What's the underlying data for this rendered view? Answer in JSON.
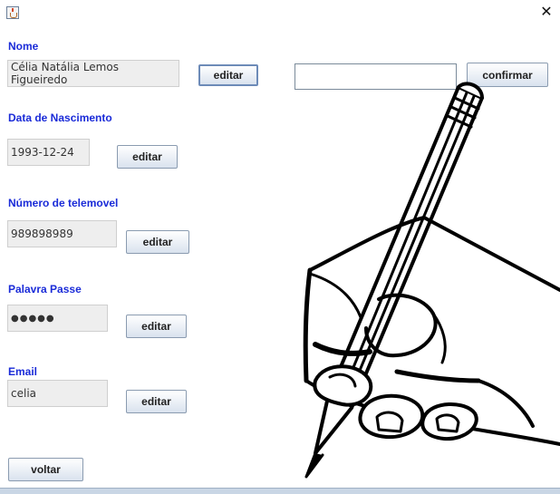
{
  "window": {
    "close_glyph": "✕",
    "icon": "java-cup-icon"
  },
  "fields": {
    "nome": {
      "label": "Nome",
      "value": "Célia Natália Lemos Figueiredo",
      "button": "editar"
    },
    "nascimento": {
      "label": "Data de Nascimento",
      "value": "1993-12-24",
      "button": "editar"
    },
    "telemovel": {
      "label": "Número de telemovel",
      "value": "989898989",
      "button": "editar"
    },
    "palavra_passe": {
      "label": "Palavra Passe",
      "value": "●●●●●",
      "button": "editar"
    },
    "email": {
      "label": "Email",
      "value": "celia",
      "button": "editar"
    }
  },
  "edit": {
    "input_value": "",
    "confirm_label": "confirmar"
  },
  "footer": {
    "back_label": "voltar"
  },
  "colors": {
    "label": "#1a2bd8",
    "field_bg": "#eeeeee"
  }
}
